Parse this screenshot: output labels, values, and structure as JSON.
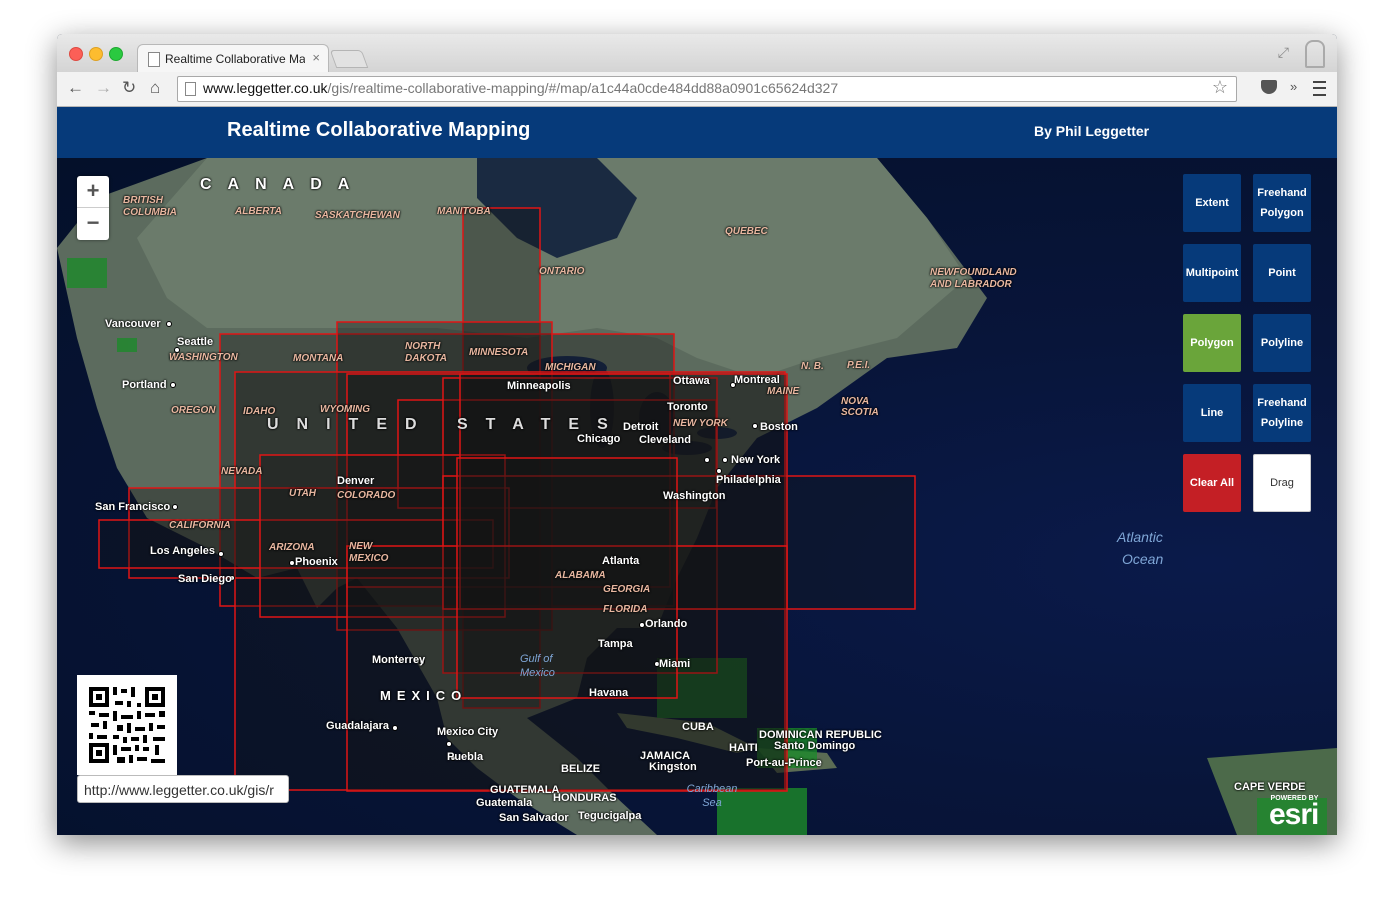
{
  "browser": {
    "tab_title": "Realtime Collaborative Map",
    "tab_close": "×",
    "url_host": "www.leggetter.co.uk",
    "url_path": "/gis/realtime-collaborative-mapping/#/map/a1c44a0cde484dd88a0901c65624d327",
    "back": "←",
    "forward": "→",
    "reload": "↻",
    "home": "⌂",
    "star": "☆",
    "extensions_more": "»"
  },
  "header": {
    "title": "Realtime Collaborative Mapping",
    "author": "By Phil Leggetter"
  },
  "map": {
    "zoom_in": "+",
    "zoom_out": "−",
    "labels": {
      "canada": "CANADA",
      "united_states": "UNITED STATES",
      "mexico": "MEXICO",
      "british_columbia": "BRITISH COLUMBIA",
      "alberta": "ALBERTA",
      "saskatchewan": "SASKATCHEWAN",
      "manitoba": "MANITOBA",
      "ontario": "ONTARIO",
      "quebec": "QUEBEC",
      "newfoundland": "NEWFOUNDLAND AND LABRADOR",
      "montana": "MONTANA",
      "north_dakota": "NORTH DAKOTA",
      "minnesota": "MINNESOTA",
      "michigan": "MICHIGAN",
      "washington": "WASHINGTON",
      "oregon": "OREGON",
      "idaho": "IDAHO",
      "wyoming": "WYOMING",
      "nevada": "NEVADA",
      "utah": "UTAH",
      "colorado": "COLORADO",
      "california": "CALIFORNIA",
      "arizona": "ARIZONA",
      "new_mexico": "NEW MEXICO",
      "alabama": "ALABAMA",
      "georgia": "GEORGIA",
      "florida": "FLORIDA",
      "new_york_state": "NEW YORK",
      "maine": "MAINE",
      "nova_scotia": "NOVA SCOTIA",
      "nb": "N. B.",
      "pei": "P.E.I.",
      "vancouver": "Vancouver",
      "seattle": "Seattle",
      "portland": "Portland",
      "san_francisco": "San Francisco",
      "los_angeles": "Los Angeles",
      "san_diego": "San Diego",
      "phoenix": "Phoenix",
      "denver": "Denver",
      "minneapolis": "Minneapolis",
      "chicago": "Chicago",
      "detroit": "Detroit",
      "cleveland": "Cleveland",
      "toronto": "Toronto",
      "ottawa": "Ottawa",
      "montreal": "Montreal",
      "boston": "Boston",
      "new_york": "New York",
      "philadelphia": "Philadelphia",
      "washington_dc": "Washington",
      "atlanta": "Atlanta",
      "orlando": "Orlando",
      "tampa": "Tampa",
      "miami": "Miami",
      "monterrey": "Monterrey",
      "guadalajara": "Guadalajara",
      "mexico_city": "Mexico City",
      "puebla": "Puebla",
      "havana": "Havana",
      "cuba": "CUBA",
      "jamaica": "JAMAICA",
      "kingston": "Kingston",
      "haiti": "HAITI",
      "dominican_republic": "DOMINICAN REPUBLIC",
      "santo_domingo": "Santo Domingo",
      "port_au_prince": "Port-au-Prince",
      "belize": "BELIZE",
      "guatemala_country": "GUATEMALA",
      "guatemala": "Guatemala",
      "honduras": "HONDURAS",
      "san_salvador": "San Salvador",
      "tegucigalpa": "Tegucigalpa",
      "cape_verde": "CAPE VERDE",
      "gulf_of_mexico": "Gulf of Mexico",
      "caribbean_sea": "Caribbean Sea",
      "atlantic_ocean_1": "Atlantic",
      "atlantic_ocean_2": "Ocean"
    }
  },
  "tools": [
    {
      "label": "Extent"
    },
    {
      "label": "Freehand Polygon"
    },
    {
      "label": "Multipoint"
    },
    {
      "label": "Point"
    },
    {
      "label": "Polygon"
    },
    {
      "label": "Polyline"
    },
    {
      "label": "Line"
    },
    {
      "label": "Freehand Polyline"
    },
    {
      "label": "Clear All"
    },
    {
      "label": "Drag"
    }
  ],
  "colors": {
    "header_bg": "#063a7a",
    "tool_bg": "#063a7a",
    "tool_active": "#6aa53a",
    "clear_all": "#c41f25",
    "extent_stroke": "#e01515"
  },
  "qr": {
    "url": "http://www.leggetter.co.uk/gis/r"
  },
  "attribution": {
    "powered_by": "POWERED BY",
    "brand": "esri"
  }
}
